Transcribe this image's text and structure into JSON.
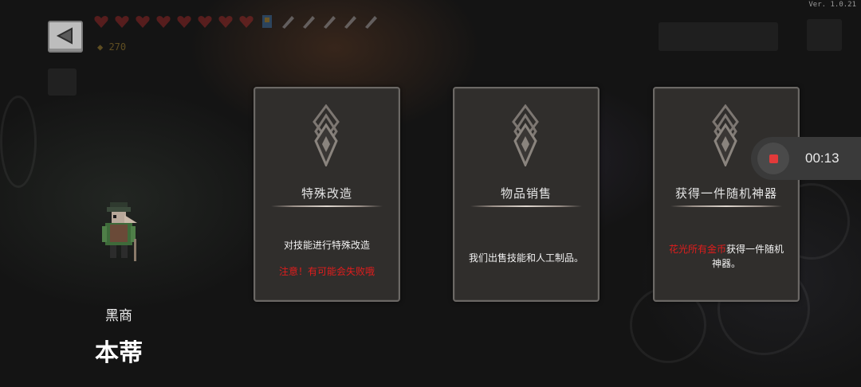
{
  "version": "Ver. 1.0.21",
  "hud": {
    "coins": "270",
    "hearts": 8,
    "shields": 5
  },
  "npc": {
    "role": "黑商",
    "name": "本蒂"
  },
  "cards": [
    {
      "title": "特殊改造",
      "desc_lines": [
        "对技能进行特殊改造"
      ],
      "warning": "注意！有可能会失败哦"
    },
    {
      "title": "物品销售",
      "desc_lines": [
        "我们出售技能和人工制品。"
      ]
    },
    {
      "title": "获得一件随机神器",
      "desc_red": "花光所有金币",
      "desc_rest": "获得一件随机",
      "desc_line2": "神器。"
    }
  ],
  "recording": {
    "time": "00:13"
  },
  "colors": {
    "card_bg": "#302e2c",
    "card_border": "#6b6865",
    "warning": "#e11d1d",
    "record_red": "#e23a3a"
  },
  "icons": {
    "back": "back-arrow-icon",
    "card_emblem": "diamond-emblem-icon",
    "record": "stop-record-icon"
  }
}
